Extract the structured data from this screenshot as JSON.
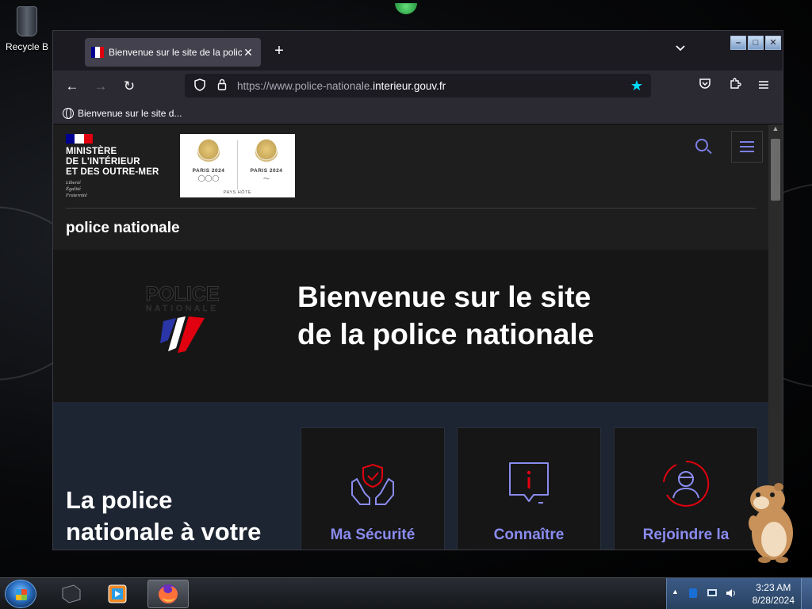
{
  "desktop": {
    "recycle_label": "Recycle B"
  },
  "browser": {
    "tab": {
      "title": "Bienvenue sur le site de la police nationale",
      "close_symbol": "✕"
    },
    "new_tab_symbol": "+",
    "tab_list_symbol": "⌄",
    "window_controls": [
      "–",
      "□",
      "✕"
    ],
    "nav": {
      "back": "←",
      "forward": "→",
      "reload": "↻"
    },
    "url": {
      "prefix": "https://www.police-nationale.",
      "domain": "interieur.gouv.fr"
    },
    "bookmark": {
      "label": "Bienvenue sur le site d..."
    }
  },
  "site": {
    "ministry": [
      "MINISTÈRE",
      "DE L'INTÉRIEUR",
      "ET DES OUTRE-MER"
    ],
    "devise": [
      "Liberté",
      "Égalité",
      "Fraternité"
    ],
    "paris_label_left": "PARIS 2024",
    "paris_label_right": "PARIS 2024",
    "paris_host": "PAYS HÔTE",
    "service_name": "police nationale",
    "logo": {
      "line1": "POLICE",
      "line2": "NATIONALE"
    },
    "hero_title": [
      "Bienvenue sur le site",
      "de la police nationale"
    ],
    "band_title": [
      "La police",
      "nationale à votre"
    ],
    "cards": [
      {
        "label": "Ma Sécurité",
        "icon": "hands-shield-icon"
      },
      {
        "label": "Connaître",
        "icon": "info-bubble-icon"
      },
      {
        "label": "Rejoindre la",
        "icon": "recruit-person-icon"
      }
    ]
  },
  "taskbar": {
    "time": "3:23 AM",
    "date": "8/28/2024"
  },
  "colors": {
    "accent": "#8a8cf0",
    "icon_red": "#e1000f",
    "url_star": "#00ddff",
    "flag_blue": "#000091",
    "flag_red": "#e1000f"
  }
}
